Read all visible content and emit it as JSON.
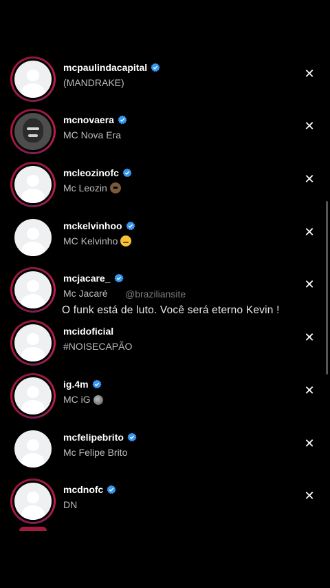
{
  "rows": [
    {
      "username": "mcpaulindacapital",
      "fullname": "(MANDRAKE)",
      "verified": true,
      "ring": true,
      "photo": false,
      "emoji": ""
    },
    {
      "username": "mcnovaera",
      "fullname": "MC Nova Era",
      "verified": true,
      "ring": true,
      "photo": true,
      "emoji": ""
    },
    {
      "username": "mcleozinofc",
      "fullname": "Mc Leozin",
      "verified": true,
      "ring": true,
      "photo": false,
      "emoji": "bear"
    },
    {
      "username": "mckelvinhoo",
      "fullname": "MC Kelvinho",
      "verified": true,
      "ring": false,
      "photo": false,
      "emoji": "sad"
    },
    {
      "username": "mcjacare_",
      "fullname": "Mc Jacaré",
      "verified": true,
      "ring": true,
      "photo": false,
      "emoji": ""
    },
    {
      "username": "mcidoficial",
      "fullname": "#NOISECAPÃO",
      "verified": false,
      "ring": true,
      "photo": false,
      "emoji": ""
    },
    {
      "username": "ig.4m",
      "fullname": "MC iG",
      "verified": true,
      "ring": true,
      "photo": false,
      "emoji": "ball"
    },
    {
      "username": "mcfelipebrito",
      "fullname": "Mc Felipe Brito",
      "verified": true,
      "ring": false,
      "photo": false,
      "emoji": ""
    },
    {
      "username": "mcdnofc",
      "fullname": "DN",
      "verified": true,
      "ring": true,
      "photo": false,
      "emoji": ""
    }
  ],
  "close_glyph": "✕",
  "watermark": "@braziliansite",
  "caption": "O funk está de luto. Você será eterno Kevin !",
  "colors": {
    "verified": "#3897f0",
    "ring": "#c21f4a",
    "background": "#000000"
  }
}
